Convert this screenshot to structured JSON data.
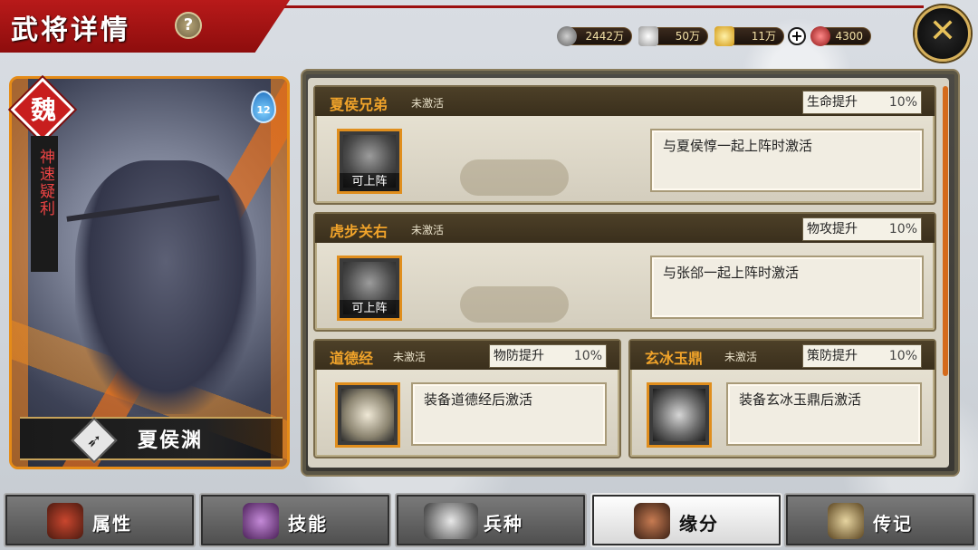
{
  "header": {
    "title": "武将详情",
    "help_label": "?"
  },
  "currencies": [
    {
      "name": "copper",
      "value": "2442万",
      "icon": "coin-icon",
      "color": "#8a8a8a"
    },
    {
      "name": "silver",
      "value": "50万",
      "icon": "silver-ingot-icon",
      "color": "#c9c9c9"
    },
    {
      "name": "gold",
      "value": "11万",
      "icon": "gold-ingot-icon",
      "color": "#f3c33a"
    },
    {
      "name": "gem",
      "value": "4300",
      "icon": "red-gem-icon",
      "color": "#c52b2b"
    }
  ],
  "plus_label": "+",
  "close_label": "✕",
  "hero": {
    "faction": "魏",
    "title": "神速疑利",
    "star_level": "12",
    "name": "夏侯渊"
  },
  "bonds": [
    {
      "name": "夏侯兄弟",
      "status": "未激活",
      "attr_label": "生命提升",
      "attr_value": "10%",
      "tile_label": "可上阵",
      "description": "与夏侯惇一起上阵时激活"
    },
    {
      "name": "虎步关右",
      "status": "未激活",
      "attr_label": "物攻提升",
      "attr_value": "10%",
      "tile_label": "可上阵",
      "description": "与张郃一起上阵时激活"
    },
    {
      "name": "道德经",
      "status": "未激活",
      "attr_label": "物防提升",
      "attr_value": "10%",
      "description": "装备道德经后激活"
    },
    {
      "name": "玄冰玉鼎",
      "status": "未激活",
      "attr_label": "策防提升",
      "attr_value": "10%",
      "description": "装备玄冰玉鼎后激活"
    }
  ],
  "tabs": [
    {
      "label": "属性",
      "icon": "helmet-icon"
    },
    {
      "label": "技能",
      "icon": "skill-scroll-icon"
    },
    {
      "label": "兵种",
      "icon": "tiger-icon"
    },
    {
      "label": "缘分",
      "icon": "handshake-icon",
      "active": true
    },
    {
      "label": "传记",
      "icon": "scroll-icon"
    }
  ],
  "colors": {
    "accent_red": "#b81a1a",
    "bond_name_orange": "#f0a32a",
    "tile_border": "#e08e1d"
  }
}
